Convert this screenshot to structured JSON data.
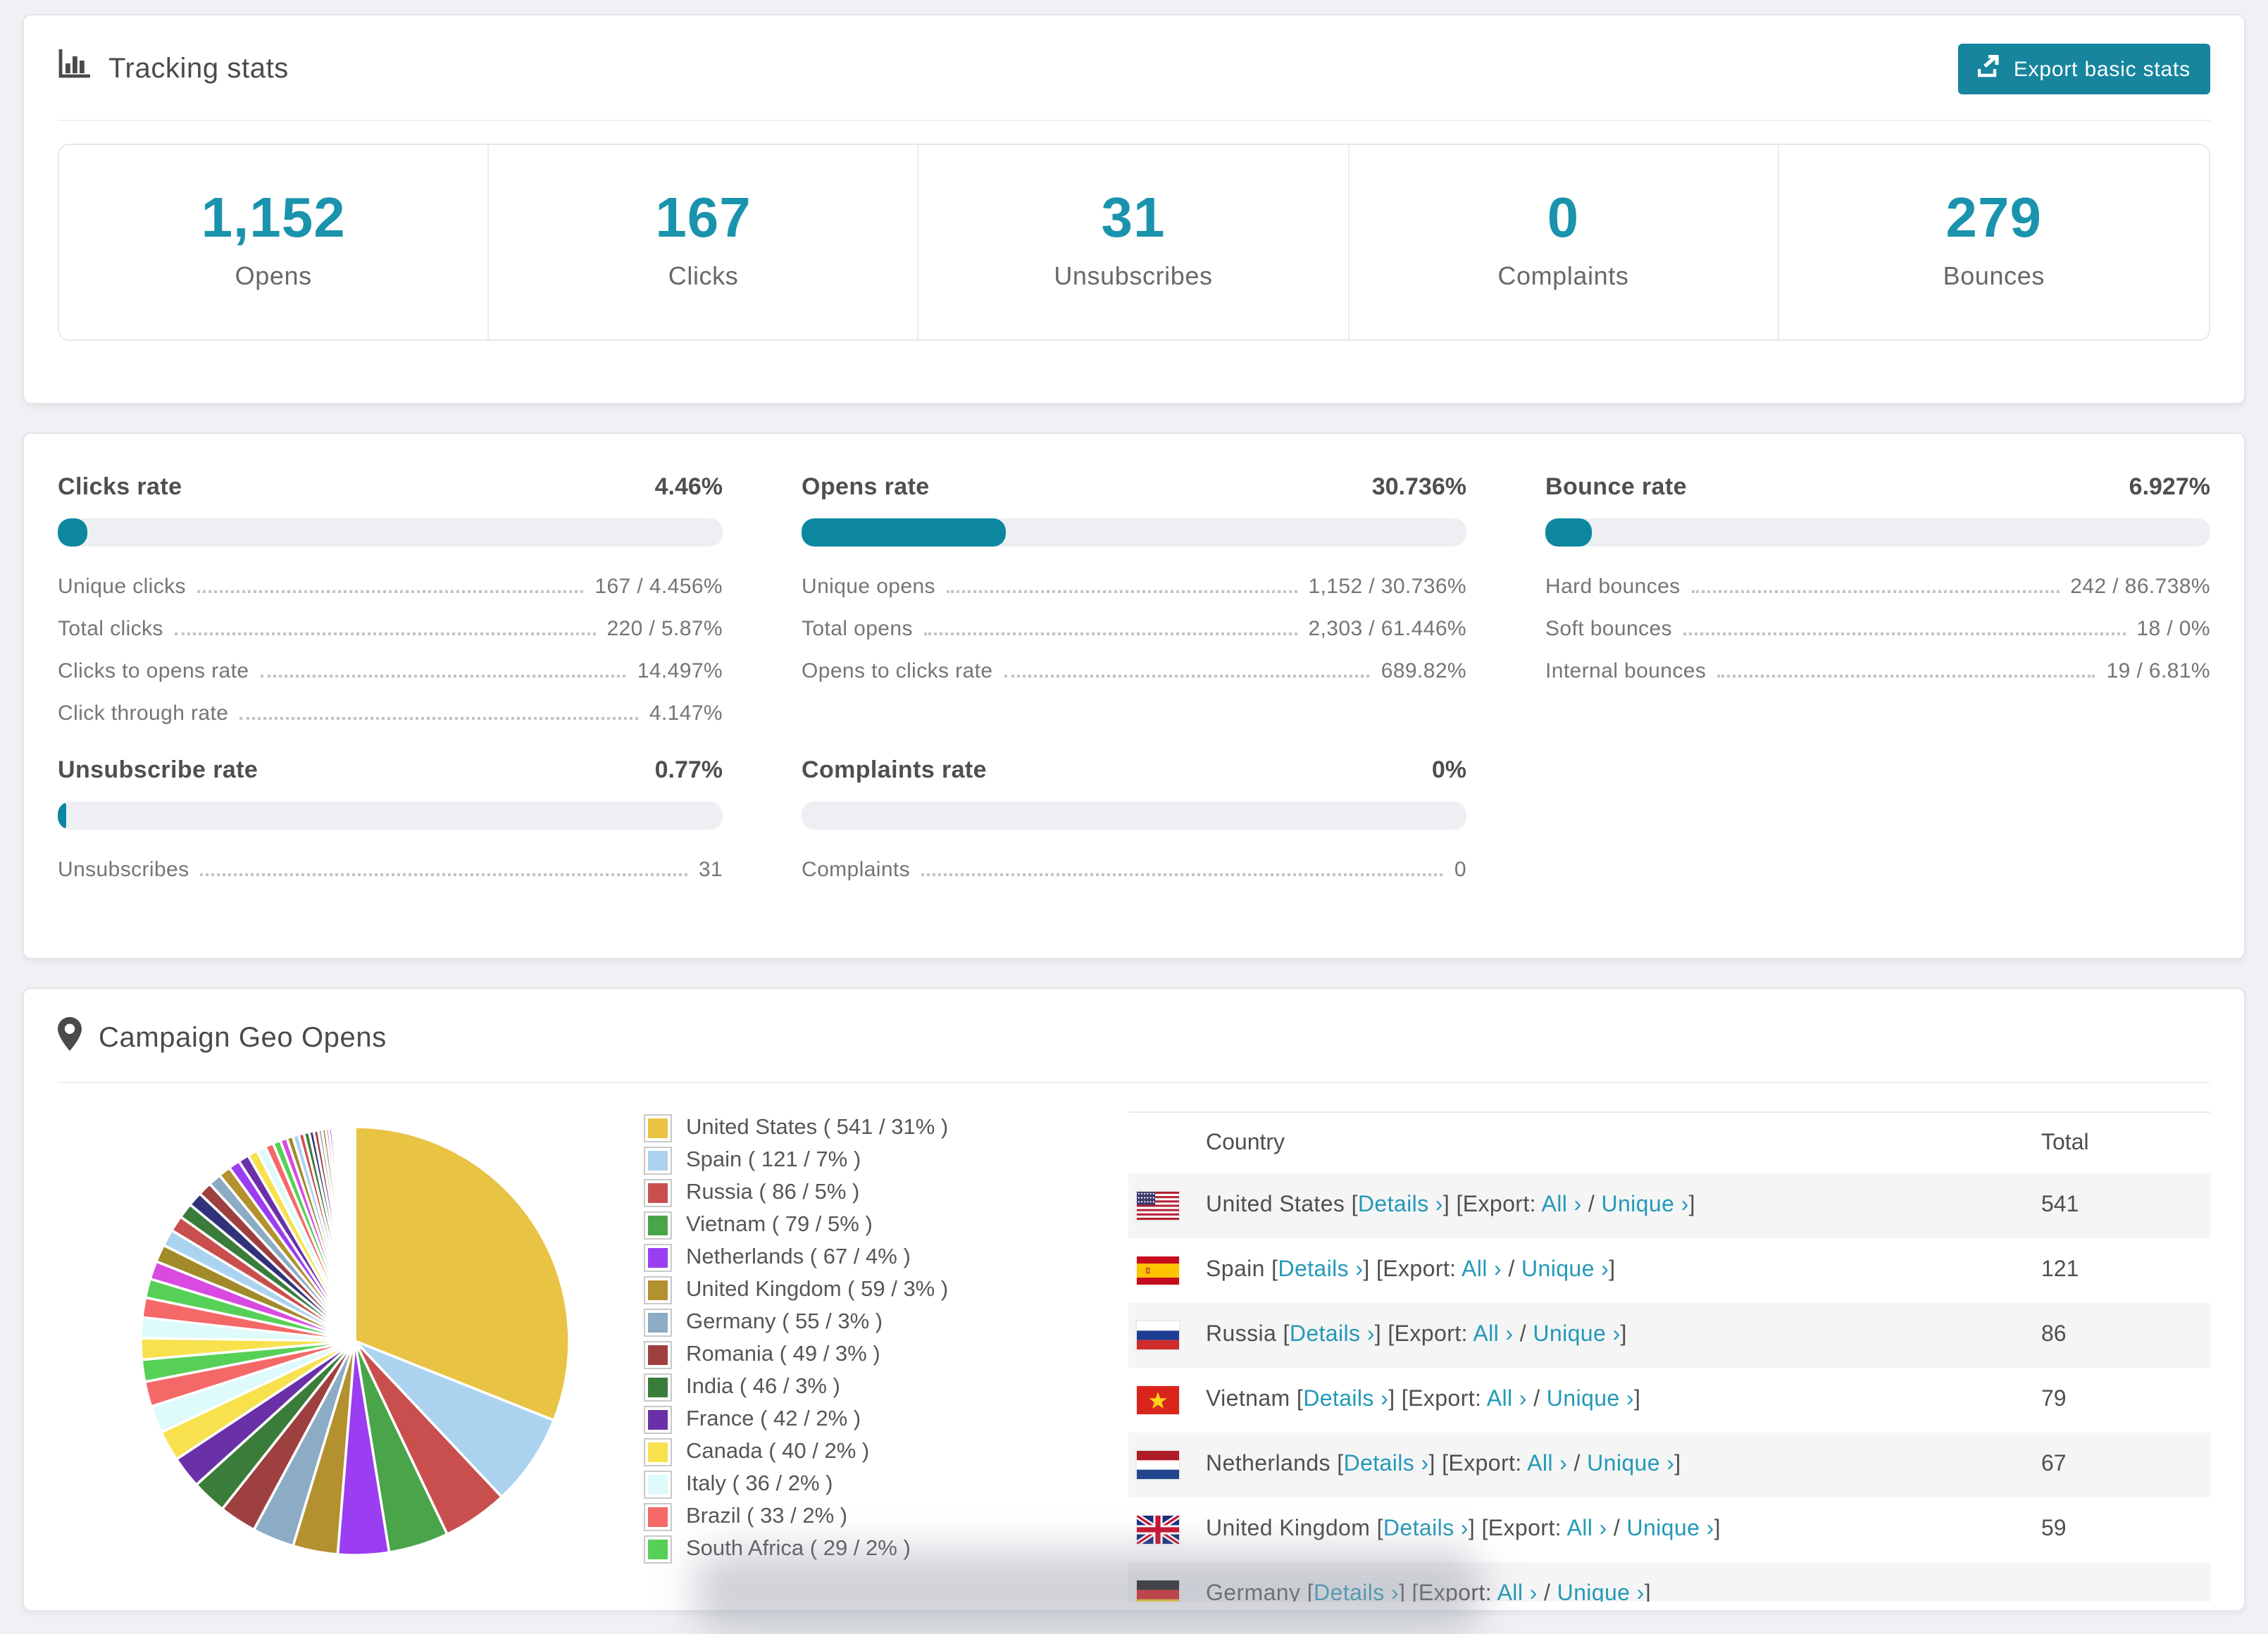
{
  "colors": {
    "accent": "#1a93ad",
    "accent_dark": "#0d87a0",
    "button": "#17859e",
    "link": "#2399b8",
    "bar_track": "#edeff2",
    "row_shade": "#f5f5f6"
  },
  "tracking_card": {
    "title": "Tracking stats",
    "title_icon": "bar-chart-icon",
    "export_button": {
      "label": "Export basic stats",
      "icon": "export-icon"
    },
    "stats": [
      {
        "value": "1,152",
        "label": "Opens"
      },
      {
        "value": "167",
        "label": "Clicks"
      },
      {
        "value": "31",
        "label": "Unsubscribes"
      },
      {
        "value": "0",
        "label": "Complaints"
      },
      {
        "value": "279",
        "label": "Bounces"
      }
    ]
  },
  "rates_card": {
    "sections": [
      {
        "title": "Clicks rate",
        "value": "4.46%",
        "bar_percent": 4.46,
        "rows": [
          {
            "label": "Unique clicks",
            "value": "167 / 4.456%"
          },
          {
            "label": "Total clicks",
            "value": "220 / 5.87%"
          },
          {
            "label": "Clicks to opens rate",
            "value": "14.497%"
          },
          {
            "label": "Click through rate",
            "value": "4.147%"
          }
        ]
      },
      {
        "title": "Opens rate",
        "value": "30.736%",
        "bar_percent": 30.736,
        "rows": [
          {
            "label": "Unique opens",
            "value": "1,152 / 30.736%"
          },
          {
            "label": "Total opens",
            "value": "2,303 / 61.446%"
          },
          {
            "label": "Opens to clicks rate",
            "value": "689.82%"
          }
        ]
      },
      {
        "title": "Bounce rate",
        "value": "6.927%",
        "bar_percent": 6.927,
        "rows": [
          {
            "label": "Hard bounces",
            "value": "242 / 86.738%"
          },
          {
            "label": "Soft bounces",
            "value": "18 / 0%"
          },
          {
            "label": "Internal bounces",
            "value": "19 / 6.81%"
          }
        ]
      },
      {
        "title": "Unsubscribe rate",
        "value": "0.77%",
        "bar_percent": 0.77,
        "rows": [
          {
            "label": "Unsubscribes",
            "value": "31"
          }
        ]
      },
      {
        "title": "Complaints rate",
        "value": "0%",
        "bar_percent": 0,
        "rows": [
          {
            "label": "Complaints",
            "value": "0"
          }
        ]
      }
    ]
  },
  "geo_card": {
    "title": "Campaign Geo Opens",
    "title_icon": "map-pin-icon",
    "legend": [
      {
        "label": "United States ( 541 / 31% )",
        "color": "#e8c344"
      },
      {
        "label": "Spain ( 121 / 7% )",
        "color": "#abd3f0"
      },
      {
        "label": "Russia ( 86 / 5% )",
        "color": "#c94f4f"
      },
      {
        "label": "Vietnam ( 79 / 5% )",
        "color": "#4aa44a"
      },
      {
        "label": "Netherlands ( 67 / 4% )",
        "color": "#9b3df0"
      },
      {
        "label": "United Kingdom ( 59 / 3% )",
        "color": "#b3912f"
      },
      {
        "label": "Germany ( 55 / 3% )",
        "color": "#8cabc4"
      },
      {
        "label": "Romania ( 49 / 3% )",
        "color": "#9e4040"
      },
      {
        "label": "India ( 46 / 3% )",
        "color": "#3a7c3a"
      },
      {
        "label": "France ( 42 / 2% )",
        "color": "#6930a8"
      },
      {
        "label": "Canada ( 40 / 2% )",
        "color": "#f7e14c"
      },
      {
        "label": "Italy ( 36 / 2% )",
        "color": "#defafa"
      },
      {
        "label": "Brazil ( 33 / 2% )",
        "color": "#f56868"
      },
      {
        "label": "South Africa ( 29 / 2% )",
        "color": "#57d057"
      }
    ],
    "table": {
      "headers": [
        "Country",
        "Total"
      ],
      "link_labels": {
        "details": "Details",
        "export": "Export:",
        "all": "All",
        "unique": "Unique",
        "chevron": "›"
      },
      "rows": [
        {
          "country": "United States",
          "flag": "us",
          "total": "541"
        },
        {
          "country": "Spain",
          "flag": "es",
          "total": "121"
        },
        {
          "country": "Russia",
          "flag": "ru",
          "total": "86"
        },
        {
          "country": "Vietnam",
          "flag": "vn",
          "total": "79"
        },
        {
          "country": "Netherlands",
          "flag": "nl",
          "total": "67"
        },
        {
          "country": "United Kingdom",
          "flag": "gb",
          "total": "59"
        },
        {
          "country": "Germany",
          "flag": "de",
          "total": "",
          "partial": true
        }
      ]
    }
  },
  "chart_data": {
    "type": "pie",
    "title": "Campaign Geo Opens",
    "legend_position": "right",
    "start_angle_deg": 0,
    "direction": "clockwise",
    "categories": [
      "United States",
      "Spain",
      "Russia",
      "Vietnam",
      "Netherlands",
      "United Kingdom",
      "Germany",
      "Romania",
      "India",
      "France",
      "Canada",
      "Italy",
      "Brazil",
      "South Africa"
    ],
    "values": [
      541,
      121,
      86,
      79,
      67,
      59,
      55,
      49,
      46,
      42,
      40,
      36,
      33,
      29
    ],
    "percent_labels": [
      "31%",
      "7%",
      "5%",
      "5%",
      "4%",
      "3%",
      "3%",
      "3%",
      "3%",
      "2%",
      "2%",
      "2%",
      "2%",
      "2%"
    ],
    "colors": [
      "#e8c344",
      "#abd3f0",
      "#c94f4f",
      "#4aa44a",
      "#9b3df0",
      "#b3912f",
      "#8cabc4",
      "#9e4040",
      "#3a7c3a",
      "#6930a8",
      "#f7e14c",
      "#defafa",
      "#f56868",
      "#57d057"
    ],
    "unlabeled_small_slices_estimated": [
      28,
      27,
      26,
      25,
      24,
      23,
      22,
      21,
      20,
      19,
      18,
      17,
      16,
      15,
      14,
      13,
      12,
      11,
      10,
      9,
      8,
      8,
      7,
      7,
      6,
      6,
      5,
      5,
      4,
      4,
      3,
      3,
      3,
      2,
      2,
      2,
      2,
      1,
      1,
      1,
      1,
      1,
      1,
      1,
      1,
      1,
      1,
      1,
      1,
      1
    ],
    "others_color_cycle": [
      "#f7e14c",
      "#defafa",
      "#f56868",
      "#57d057",
      "#d94ae0",
      "#a08a2a",
      "#abd3f0",
      "#c94f4f",
      "#3a7c3a",
      "#32327a",
      "#9e4040",
      "#8cabc4",
      "#b3912f",
      "#9b3df0",
      "#6930a8"
    ]
  }
}
